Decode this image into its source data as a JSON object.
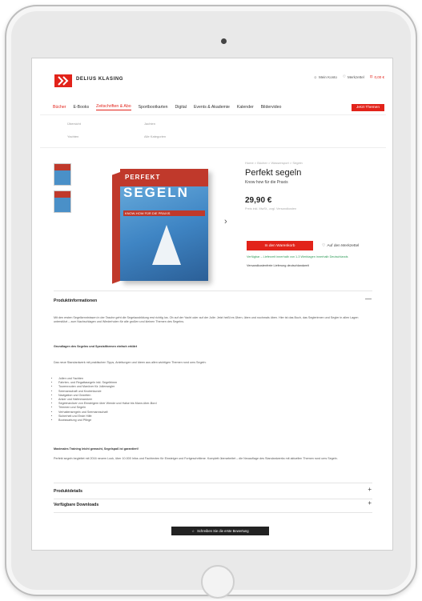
{
  "brand": {
    "mark": "DK",
    "name": "DELIUS KLASING"
  },
  "header_links": {
    "account": "Mein Konto",
    "wishlist": "Merkzettel",
    "cart": "0,00 €"
  },
  "nav": {
    "items": [
      "Bücher",
      "E-Books",
      "Zeitschriften & Abo",
      "Sportbootkarten",
      "Digital",
      "Events & Akademie",
      "Kalender",
      "Bildervideo"
    ],
    "cta": "Jetzt Themen"
  },
  "mega": {
    "col1": [
      "Übersicht",
      "Yachten"
    ],
    "col2": [
      "Jachten",
      "Alle Kategorien"
    ]
  },
  "product": {
    "breadcrumb": "Home > Bücher > Wassersport > Segeln",
    "title": "Perfekt segeln",
    "subtitle": "Know how für die Praxis",
    "price": "29,90 €",
    "tax_note": "Preis inkl. MwSt., zzgl. Versandkosten",
    "cart_button": "In den Warenkorb",
    "wishlist_button": "Auf den Merkzettel",
    "availability": "Verfügbar – Lieferzeit innerhalb von 1-3 Werktagen innerhalb Deutschlands",
    "shipping": "Versandkostenfreie Lieferung deutschlandweit"
  },
  "book_cover": {
    "top": "PERFEKT",
    "title": "SEGELN",
    "subtitle": "KNOW-HOW FÜR DIE PRAXIS"
  },
  "sections": {
    "info_title": "Produktinformationen",
    "info_toggle": "—",
    "info_intro": "Mit den ersten Segelkenntnissen in der Tasche geht die Segelausbildung erst richtig los. Ob auf der Yacht oder auf der Jolle: Jetzt heißt es Üben, üben und nochmals üben. Hier ist das Buch, das Seglerinnen und Segler in allen Lagen unterstützt – zum Nachschlagen und Wiederholen für alle großen und kleinen Themen des Segelns.",
    "info_subhead": "Grundlagen des Segelns und Spezialthemen einfach erklärt",
    "info_text2": "Das neue Standardwerk mit praktischen Tipps, Anleitungen und Ideen aus allen wichtigen Themen rund ums Segeln:",
    "features": [
      "Jollen und Yachten",
      "Fahrten- und Regattasegeln inkl. Segeltrimm",
      "Tourenrouten und Manöver für Jollensegler",
      "Seemanschaft und Knotenkunde",
      "Navigation und Gezeiten",
      "Anker und Hafenmanöver",
      "Segelmanöver von Einsteigern über Wende und Halse bis Mann-über-Bord",
      "Trimmen und Segeln",
      "Verhaltensregeln und Seemannschaft",
      "Sicherheit und Erste Hilfe",
      "Bootswartung und Pflege"
    ],
    "closing_subhead": "Maximales Training leicht gemacht, Segelspaß ist garantiert!",
    "closing_text": "Perfekt segeln begleitet mit 2016 neuem Look, über 10.000 Infos und Fachtexten für Einsteiger und Fortgeschrittene. Komplett überarbeitet – die Neuauflage des Standardwerks mit aktuellen Themen rund ums Segeln.",
    "details_title": "Produktdetails",
    "downloads_title": "Verfügbare Downloads",
    "plus": "+"
  },
  "review_button": "Schreiben Sie die erste Bewertung"
}
